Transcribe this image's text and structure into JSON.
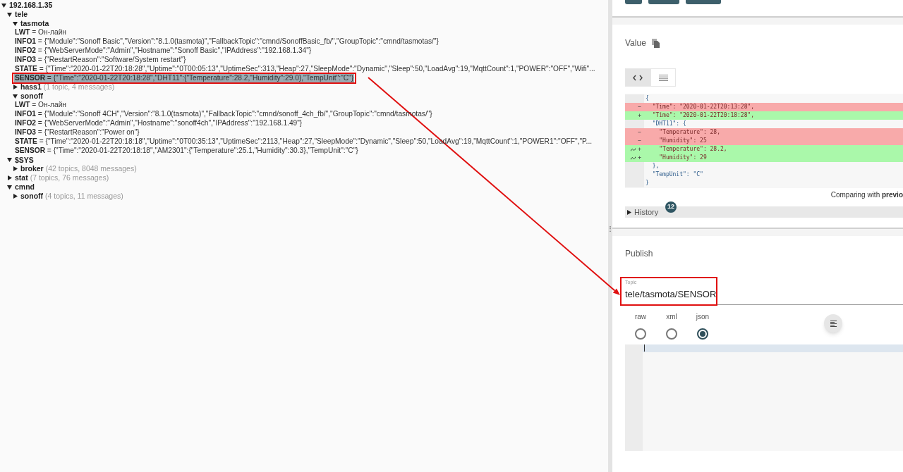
{
  "tree": [
    {
      "name": "192.168.1.35",
      "expanded": true,
      "children": [
        {
          "name": "tele",
          "expanded": true,
          "children": [
            {
              "name": "tasmota",
              "expanded": true,
              "children": [
                {
                  "name": "LWT",
                  "value": "= Он-лайн",
                  "selected": false
                },
                {
                  "name": "INFO1",
                  "value": "= {\"Module\":\"Sonoff Basic\",\"Version\":\"8.1.0(tasmota)\",\"FallbackTopic\":\"cmnd/SonoffBasic_fb/\",\"GroupTopic\":\"cmnd/tasmotas/\"}",
                  "selected": false
                },
                {
                  "name": "INFO2",
                  "value": "= {\"WebServerMode\":\"Admin\",\"Hostname\":\"Sonoff Basic\",\"IPAddress\":\"192.168.1.34\"}",
                  "selected": false
                },
                {
                  "name": "INFO3",
                  "value": "= {\"RestartReason\":\"Software/System restart\"}",
                  "selected": false
                },
                {
                  "name": "STATE",
                  "value": "= {\"Time\":\"2020-01-22T20:18:28\",\"Uptime\":\"0T00:05:13\",\"UptimeSec\":313,\"Heap\":27,\"SleepMode\":\"Dynamic\",\"Sleep\":50,\"LoadAvg\":19,\"MqttCount\":1,\"POWER\":\"OFF\",\"Wifi\"...",
                  "selected": false
                },
                {
                  "name": "SENSOR",
                  "value": "= {\"Time\":\"2020-01-22T20:18:28\",\"DHT11\":{\"Temperature\":28.2,\"Humidity\":29.0},\"TempUnit\":\"C\"}",
                  "selected": true,
                  "annotated": true
                }
              ]
            },
            {
              "name": "hass1",
              "expanded": false,
              "summary": "(1 topic, 4 messages)"
            },
            {
              "name": "sonoff",
              "expanded": true,
              "children": [
                {
                  "name": "LWT",
                  "value": "= Он-лайн",
                  "selected": false
                },
                {
                  "name": "INFO1",
                  "value": "= {\"Module\":\"Sonoff 4CH\",\"Version\":\"8.1.0(tasmota)\",\"FallbackTopic\":\"cmnd/sonoff_4ch_fb/\",\"GroupTopic\":\"cmnd/tasmotas/\"}",
                  "selected": false
                },
                {
                  "name": "INFO2",
                  "value": "= {\"WebServerMode\":\"Admin\",\"Hostname\":\"sonoff4ch\",\"IPAddress\":\"192.168.1.49\"}",
                  "selected": false
                },
                {
                  "name": "INFO3",
                  "value": "= {\"RestartReason\":\"Power on\"}",
                  "selected": false
                },
                {
                  "name": "STATE",
                  "value": "= {\"Time\":\"2020-01-22T20:18:18\",\"Uptime\":\"0T00:35:13\",\"UptimeSec\":2113,\"Heap\":27,\"SleepMode\":\"Dynamic\",\"Sleep\":50,\"LoadAvg\":19,\"MqttCount\":1,\"POWER1\":\"OFF\",\"P...",
                  "selected": false
                },
                {
                  "name": "SENSOR",
                  "value": "= {\"Time\":\"2020-01-22T20:18:18\",\"AM2301\":{\"Temperature\":25.1,\"Humidity\":30.3},\"TempUnit\":\"C\"}",
                  "selected": false
                }
              ]
            }
          ]
        },
        {
          "name": "$SYS",
          "expanded": true,
          "children": [
            {
              "name": "broker",
              "expanded": false,
              "summary": "(42 topics, 8048 messages)"
            }
          ]
        },
        {
          "name": "stat",
          "expanded": false,
          "summary": "(7 topics, 76 messages)"
        },
        {
          "name": "cmnd",
          "expanded": true,
          "children": [
            {
              "name": "sonoff",
              "expanded": false,
              "summary": "(4 topics, 11 messages)"
            }
          ]
        }
      ]
    }
  ],
  "value_panel": {
    "title": "Value",
    "view_modes": [
      {
        "kind": "code",
        "selected": true
      },
      {
        "kind": "list",
        "selected": false
      }
    ],
    "diff": [
      {
        "kind": "context",
        "text": "{"
      },
      {
        "kind": "removed",
        "marker": "−",
        "text": "  \"Time\": \"2020-01-22T20:13:28\","
      },
      {
        "kind": "added",
        "marker": "+",
        "text": "  \"Time\": \"2020-01-22T20:18:28\","
      },
      {
        "kind": "context",
        "text": "  \"DHT11\": {"
      },
      {
        "kind": "removed",
        "marker": "−",
        "text": "    \"Temperature\": 28,"
      },
      {
        "kind": "removed",
        "marker": "−",
        "text": "    \"Humidity\": 25"
      },
      {
        "kind": "added",
        "marker": "+",
        "text": "    \"Temperature\": 28.2,",
        "changed": true
      },
      {
        "kind": "added",
        "marker": "+",
        "text": "    \"Humidity\": 29",
        "changed": true
      },
      {
        "kind": "context",
        "text": "  },"
      },
      {
        "kind": "context",
        "text": "  \"TempUnit\": \"C\""
      },
      {
        "kind": "context",
        "text": "}"
      }
    ],
    "comparing": "Comparing with **previo**",
    "history": {
      "label": "History",
      "expanded": false,
      "count": "12"
    }
  },
  "publish": {
    "title": "Publish",
    "topic_label": "Topic",
    "topic": "tele/tasmota/SENSOR",
    "topic_annotated": true,
    "formats": [
      {
        "label": "raw",
        "selected": false
      },
      {
        "label": "xml",
        "selected": false
      },
      {
        "label": "json",
        "selected": true
      }
    ]
  }
}
